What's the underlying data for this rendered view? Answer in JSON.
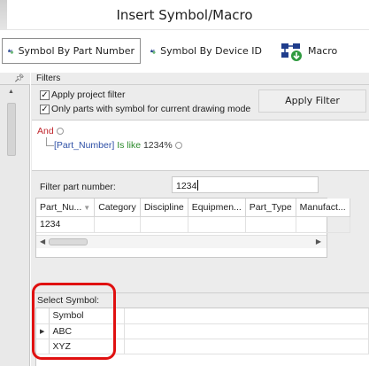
{
  "window": {
    "title": "Insert Symbol/Macro"
  },
  "toolbar": {
    "part_number_label": "Symbol By Part Number",
    "device_id_label": "Symbol By Device ID",
    "macro_label": "Macro"
  },
  "filters": {
    "header": "Filters",
    "apply_project_label": "Apply project filter",
    "apply_project_checked": true,
    "only_parts_label": "Only parts with symbol for current drawing mode",
    "only_parts_checked": true,
    "apply_button": "Apply Filter",
    "expression": {
      "operator": "And",
      "field": "[Part_Number]",
      "op": "Is like",
      "value": "1234%"
    }
  },
  "filter_part": {
    "label": "Filter part number:",
    "value": "1234"
  },
  "parts_table": {
    "columns": [
      "Part_Nu...",
      "Category",
      "Discipline",
      "Equipmen...",
      "Part_Type",
      "Manufact..."
    ],
    "rows": [
      [
        "1234",
        "",
        "",
        "",
        "",
        ""
      ]
    ]
  },
  "select_symbol": {
    "label": "Select Symbol:",
    "column": "Symbol",
    "rows": [
      "ABC",
      "XYZ"
    ]
  },
  "colors": {
    "highlight": "#e01010",
    "and_operator": "#c0262d",
    "field": "#2d4fa6",
    "operator": "#2a8a2a"
  }
}
